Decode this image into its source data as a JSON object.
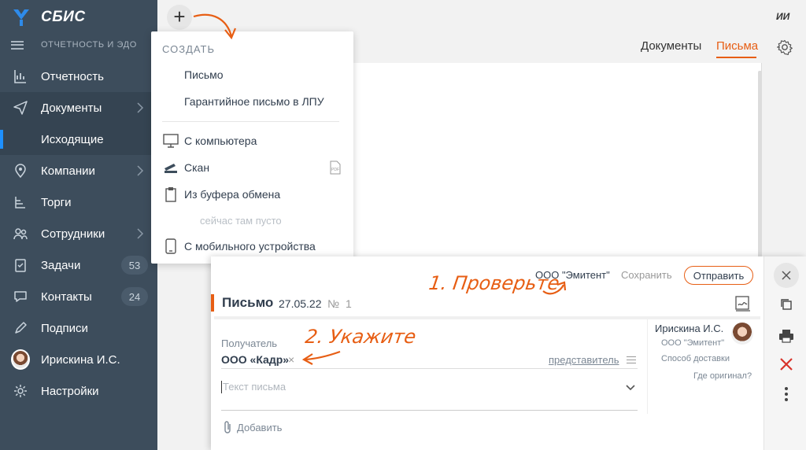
{
  "app": {
    "brand": "СБИС",
    "section": "ОТЧЕТНОСТЬ И ЭДО",
    "user_initials": "ИИ",
    "accent": "#e75e14",
    "sidebar_bg": "#3d4d5c"
  },
  "sidebar": {
    "items": [
      {
        "label": "Отчетность",
        "icon": "chart-icon"
      },
      {
        "label": "Документы",
        "icon": "send-icon"
      },
      {
        "label": "Исходящие"
      },
      {
        "label": "Компании",
        "icon": "map-pin-icon"
      },
      {
        "label": "Торги",
        "icon": "stamp-icon"
      },
      {
        "label": "Сотрудники",
        "icon": "people-icon"
      },
      {
        "label": "Задачи",
        "icon": "tasks-icon",
        "badge": "53"
      },
      {
        "label": "Контакты",
        "icon": "chat-icon",
        "badge": "24"
      },
      {
        "label": "Подписи",
        "icon": "pen-icon"
      },
      {
        "label": "Ирискина И.С."
      },
      {
        "label": "Настройки",
        "icon": "gear-icon"
      }
    ]
  },
  "tabs": {
    "documents": "Документы",
    "letters": "Письма"
  },
  "create_menu": {
    "title": "СОЗДАТЬ",
    "items": [
      "Письмо",
      "Гарантийное письмо в ЛПУ"
    ],
    "from_computer": "С компьютера",
    "scan": "Скан",
    "clipboard": "Из буфера обмена",
    "clipboard_empty": "сейчас там пусто",
    "mobile": "С мобильного устройства"
  },
  "letter": {
    "org": "ООО \"Эмитент\"",
    "save": "Сохранить",
    "send": "Отправить",
    "title": "Письмо",
    "date": "27.05.22",
    "num_label": "№",
    "num": "1",
    "recipient_label": "Получатель",
    "recipient": "ООО «Кадр»",
    "recipient_remove": "×",
    "representative": "представитель",
    "text_placeholder": "Текст письма",
    "attach": "Добавить",
    "author_name": "Ирискина И.С.",
    "author_org": "ООО \"Эмитент\"",
    "delivery": "Способ доставки",
    "original": "Где оригинал?"
  },
  "annotations": {
    "step1": "1. Проверьте",
    "step2": "2. Укажите"
  }
}
